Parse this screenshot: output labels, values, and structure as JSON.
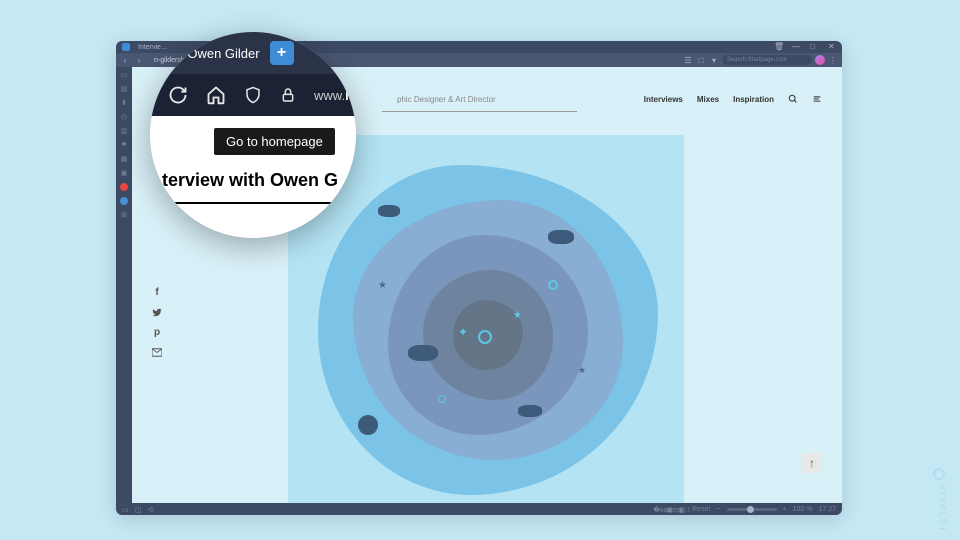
{
  "window": {
    "tab_title": "Intervie...",
    "controls": {
      "trash": "🗑",
      "min": "—",
      "max": "□",
      "close": "✕"
    }
  },
  "toolbar": {
    "url_fragment": "n-gildersleeve",
    "search_placeholder": "Search Startpage.com"
  },
  "page": {
    "subtitle": "phic Designer & Art Director",
    "nav": [
      "Interviews",
      "Mixes",
      "Inspiration"
    ]
  },
  "magnifier": {
    "tab_text": "ith Owen Gilder",
    "new_tab": "+",
    "url_prefix": "www.",
    "url_bold": "lo",
    "tooltip": "Go to homepage",
    "heading": "terview with Owen G"
  },
  "status": {
    "reset": "Reset",
    "zoom": "100 %",
    "time": "17:27"
  },
  "watermark": "VIVALDI"
}
